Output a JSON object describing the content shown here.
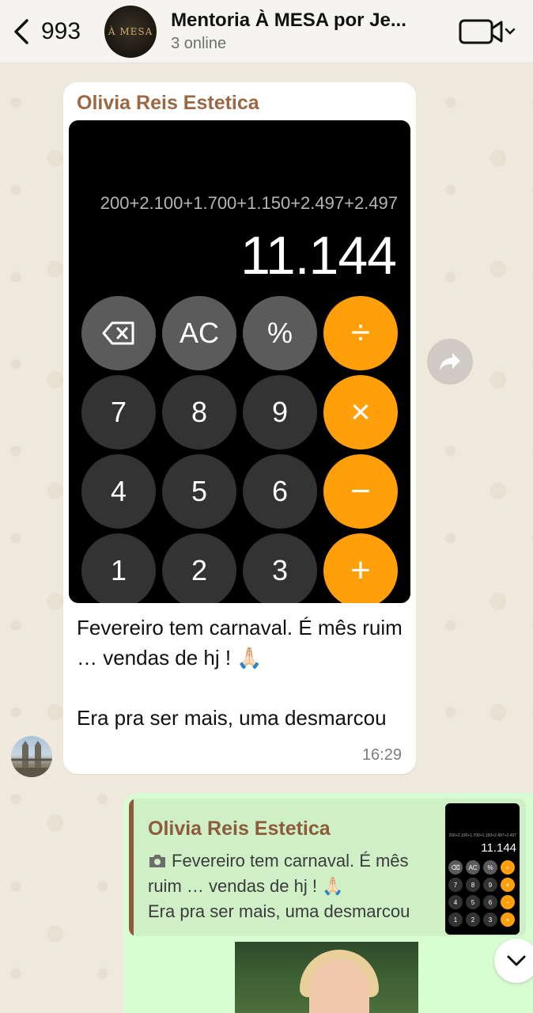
{
  "header": {
    "back_count": "993",
    "group_title": "Mentoria À MESA por Je...",
    "status": "3 online",
    "avatar_text": "À MESA"
  },
  "incoming": {
    "sender": "Olivia Reis Estetica",
    "calculator": {
      "expression": "200+2.100+1.700+1.150+2.497+2.497",
      "result": "11.144",
      "keys": [
        "⌫",
        "AC",
        "%",
        "÷",
        "7",
        "8",
        "9",
        "×",
        "4",
        "5",
        "6",
        "−",
        "1",
        "2",
        "3",
        "+"
      ]
    },
    "text": "Fevereiro tem carnaval. É mês ruim … vendas de hj ! 🙏🏻\n\nEra pra ser mais, uma desmarcou",
    "time": "16:29"
  },
  "outgoing": {
    "quote_sender": "Olivia Reis Estetica",
    "quote_line1": "Fevereiro tem carnaval. É mês",
    "quote_line2": "ruim … vendas de hj ! 🙏🏻",
    "quote_line3": "Era pra ser mais, uma desmarcou",
    "thumb_result": "11.144"
  },
  "colors": {
    "accent_orange": "#ff9f0a",
    "incoming_bubble": "#ffffff",
    "outgoing_bubble": "#d9fdd3",
    "sender_name": "#9b6844"
  }
}
